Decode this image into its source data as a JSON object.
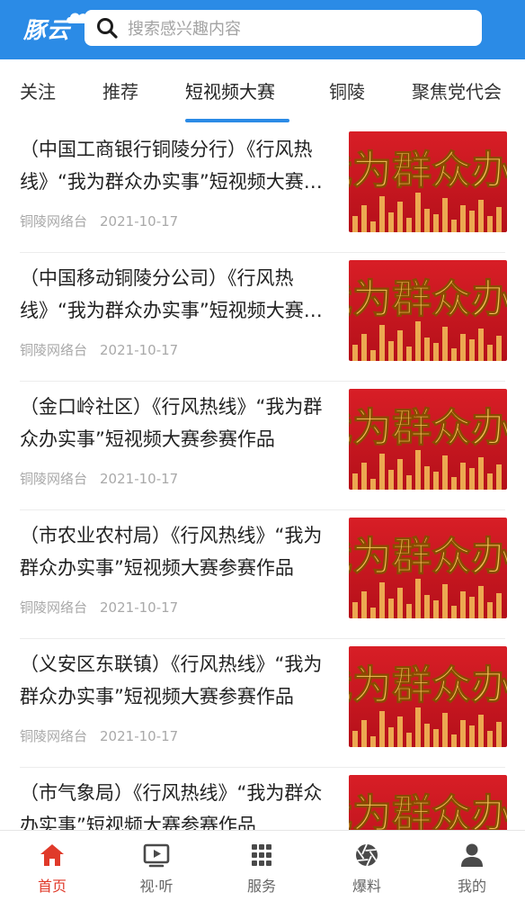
{
  "app": {
    "logo_text": "豚云"
  },
  "search": {
    "placeholder": "搜索感兴趣内容"
  },
  "tabs": [
    {
      "label": "关注"
    },
    {
      "label": "推荐"
    },
    {
      "label": "短视频大赛",
      "active": true
    },
    {
      "label": "铜陵"
    },
    {
      "label": "聚焦党代会"
    }
  ],
  "thumbnail_text": "我为群众办实事",
  "feed": [
    {
      "title": "（中国工商银行铜陵分行）《行风热线》“我为群众办实事”短视频大赛参赛作品",
      "source": "铜陵网络台",
      "date": "2021-10-17"
    },
    {
      "title": "（中国移动铜陵分公司）《行风热线》“我为群众办实事”短视频大赛参赛作品",
      "source": "铜陵网络台",
      "date": "2021-10-17"
    },
    {
      "title": "（金口岭社区）《行风热线》“我为群众办实事”短视频大赛参赛作品",
      "source": "铜陵网络台",
      "date": "2021-10-17"
    },
    {
      "title": "（市农业农村局）《行风热线》“我为群众办实事”短视频大赛参赛作品",
      "source": "铜陵网络台",
      "date": "2021-10-17"
    },
    {
      "title": "（义安区东联镇）《行风热线》“我为群众办实事”短视频大赛参赛作品",
      "source": "铜陵网络台",
      "date": "2021-10-17"
    },
    {
      "title": "（市气象局）《行风热线》“我为群众办实事”短视频大赛参赛作品",
      "source": "",
      "date": ""
    }
  ],
  "bottom_nav": [
    {
      "label": "首页",
      "icon": "home-icon",
      "active": true
    },
    {
      "label": "视·听",
      "icon": "video-icon"
    },
    {
      "label": "服务",
      "icon": "grid-icon"
    },
    {
      "label": "爆料",
      "icon": "aperture-icon"
    },
    {
      "label": "我的",
      "icon": "user-icon"
    }
  ],
  "colors": {
    "brand": "#2b8be6",
    "active_nav": "#e03a2a",
    "thumbnail_red": "#b5101a",
    "thumbnail_gold": "#f4c35a"
  }
}
